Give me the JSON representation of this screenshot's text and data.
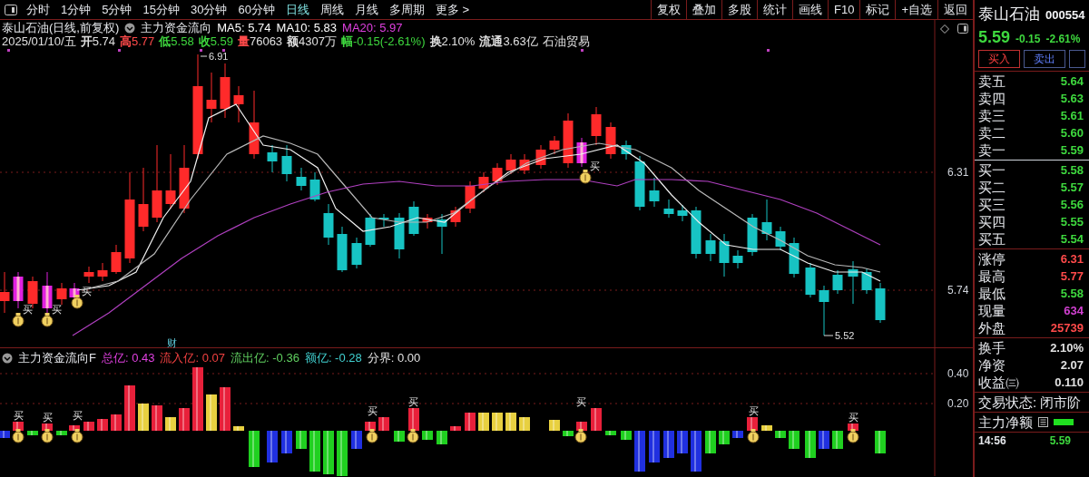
{
  "toolbar": {
    "periods": [
      {
        "label": "分时",
        "selected": false
      },
      {
        "label": "1分钟",
        "selected": false
      },
      {
        "label": "5分钟",
        "selected": false
      },
      {
        "label": "15分钟",
        "selected": false
      },
      {
        "label": "30分钟",
        "selected": false
      },
      {
        "label": "60分钟",
        "selected": false
      },
      {
        "label": "日线",
        "selected": true
      },
      {
        "label": "周线",
        "selected": false
      },
      {
        "label": "月线",
        "selected": false
      },
      {
        "label": "多周期",
        "selected": false
      }
    ],
    "more": "更多 >",
    "tools": [
      "复权",
      "叠加",
      "多股",
      "统计",
      "画线",
      "F10",
      "标记",
      "+自选",
      "返回"
    ]
  },
  "chart_header": {
    "title": "泰山石油(日线,前复权)",
    "indicator": "主力资金流向",
    "ma": [
      {
        "label": "MA5: 5.74",
        "color": "#ffffff"
      },
      {
        "label": "MA10: 5.83",
        "color": "#ffffff"
      },
      {
        "label": "MA20: 5.97",
        "color": "#e040e0"
      }
    ],
    "quote": [
      {
        "label": {
          "text": "2025/01/10/五",
          "color": "#e0e0e0"
        }
      },
      {
        "label": {
          "text": "开",
          "color": "#e0e0e0"
        },
        "value": {
          "text": "5.74",
          "color": "#e0e0e0"
        }
      },
      {
        "label": {
          "text": "高",
          "color": "#ff4a4a"
        },
        "value": {
          "text": "5.77",
          "color": "#ff4a4a"
        }
      },
      {
        "label": {
          "text": "低",
          "color": "#3ed83e"
        },
        "value": {
          "text": "5.58",
          "color": "#3ed83e"
        }
      },
      {
        "label": {
          "text": "收",
          "color": "#3ed83e"
        },
        "value": {
          "text": "5.59",
          "color": "#3ed83e"
        }
      },
      {
        "label": {
          "text": "量",
          "color": "#ff4a4a"
        },
        "value": {
          "text": "76063",
          "color": "#e0e0e0"
        }
      },
      {
        "label": {
          "text": "额",
          "color": "#e0e0e0"
        },
        "value": {
          "text": "4307万",
          "color": "#e0e0e0"
        }
      },
      {
        "label": {
          "text": "幅",
          "color": "#3ed83e"
        },
        "value": {
          "text": "-0.15(-2.61%)",
          "color": "#3ed83e"
        }
      },
      {
        "label": {
          "text": "换",
          "color": "#e0e0e0"
        },
        "value": {
          "text": "2.10%",
          "color": "#e0e0e0"
        }
      },
      {
        "label": {
          "text": "流通",
          "color": "#e0e0e0"
        },
        "value": {
          "text": "3.63亿",
          "color": "#e0e0e0"
        }
      },
      {
        "label": {
          "text": "石油贸易",
          "color": "#e0e0e0"
        }
      }
    ]
  },
  "price_axis": [
    "6.31",
    "5.74"
  ],
  "annotations": {
    "high": "6.91",
    "low": "5.52",
    "marker": "财"
  },
  "main_signals": [
    "买",
    "买",
    "买",
    "买"
  ],
  "flow_indicator": {
    "name": "主力资金流向F",
    "values": [
      {
        "label": "总亿:",
        "value": "0.43",
        "color": "#e040e0"
      },
      {
        "label": "流入亿:",
        "value": "0.07",
        "color": "#f04040"
      },
      {
        "label": "流出亿:",
        "value": "-0.36",
        "color": "#60d060"
      },
      {
        "label": "额亿:",
        "value": "-0.28",
        "color": "#40d0d0"
      },
      {
        "label": "分界:",
        "value": "0.00",
        "color": "#e0e0e0"
      }
    ],
    "axis": [
      "0.40",
      "0.20"
    ],
    "signals": [
      "买",
      "买",
      "买",
      "买",
      "买",
      "买",
      "买",
      "买"
    ]
  },
  "quote_panel": {
    "name": "泰山石油",
    "code": "000554",
    "price": "5.59",
    "change": "-0.15",
    "change_pct": "-2.61%",
    "buttons": [
      {
        "label": "买入",
        "kind": "buy"
      },
      {
        "label": "卖出",
        "kind": "sell"
      }
    ],
    "asks": [
      {
        "label": "卖五",
        "price": "5.64"
      },
      {
        "label": "卖四",
        "price": "5.63"
      },
      {
        "label": "卖三",
        "price": "5.61"
      },
      {
        "label": "卖二",
        "price": "5.60"
      },
      {
        "label": "卖一",
        "price": "5.59"
      }
    ],
    "bids": [
      {
        "label": "买一",
        "price": "5.58"
      },
      {
        "label": "买二",
        "price": "5.57"
      },
      {
        "label": "买三",
        "price": "5.56"
      },
      {
        "label": "买四",
        "price": "5.55"
      },
      {
        "label": "买五",
        "price": "5.54"
      }
    ],
    "stats": [
      {
        "label": "涨停",
        "value": "6.31",
        "color": "#ff4a4a"
      },
      {
        "label": "最高",
        "value": "5.77",
        "color": "#ff4a4a"
      },
      {
        "label": "最低",
        "value": "5.58",
        "color": "#3ed83e"
      },
      {
        "label": "现量",
        "value": "634",
        "color": "#d040d0"
      },
      {
        "label": "外盘",
        "value": "25739",
        "color": "#ff4a4a"
      }
    ],
    "stats2": [
      {
        "label": "换手",
        "value": "2.10%",
        "color": "#e0e0e0"
      },
      {
        "label": "净资",
        "value": "2.07",
        "color": "#e0e0e0"
      },
      {
        "label": "收益㈢",
        "value": "0.110",
        "color": "#e0e0e0"
      }
    ],
    "status": "交易状态: 闭市阶",
    "net_flow": "主力净额",
    "ticks": [
      {
        "time": "14:56",
        "price": "5.59"
      }
    ]
  }
}
